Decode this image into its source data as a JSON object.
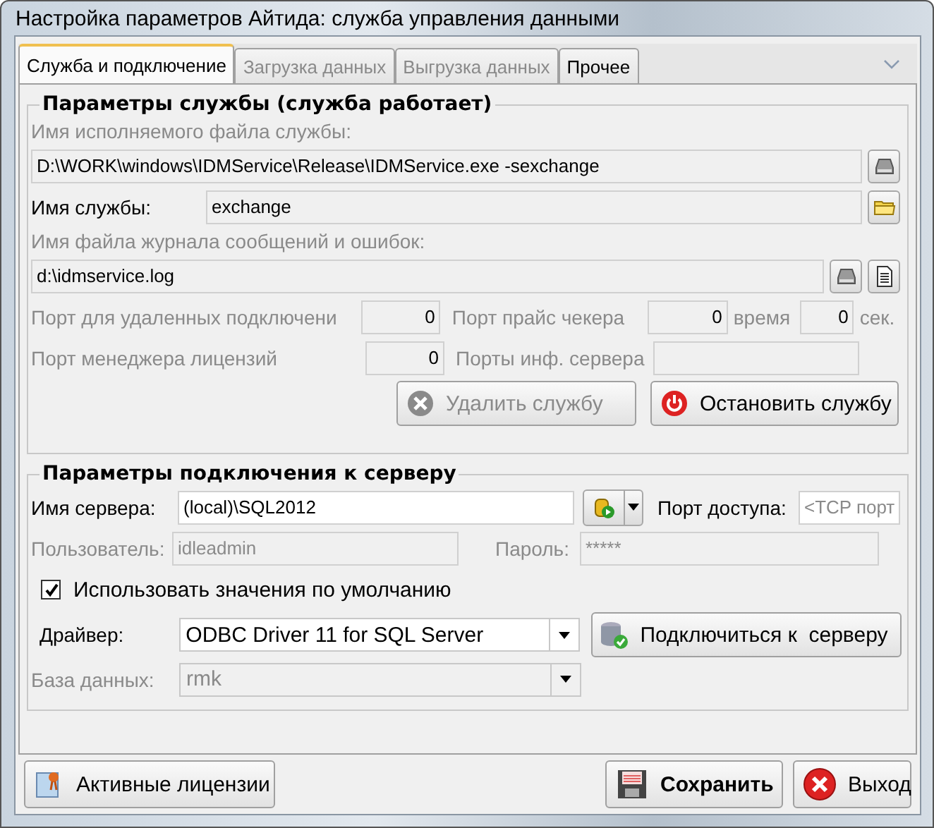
{
  "window": {
    "title": "Настройка параметров Айтида: служба управления данными"
  },
  "tabs": [
    {
      "label": "Служба и подключение",
      "selected": true,
      "disabled": false
    },
    {
      "label": "Загрузка данных",
      "selected": false,
      "disabled": true
    },
    {
      "label": "Выгрузка данных",
      "selected": false,
      "disabled": true
    },
    {
      "label": "Прочее",
      "selected": false,
      "disabled": false
    }
  ],
  "service_group": {
    "title": "Параметры службы (служба работает)",
    "exe_label": "Имя исполняемого файла службы:",
    "exe_path": "D:\\WORK\\windows\\IDMService\\Release\\IDMService.exe -sexchange",
    "service_name_label": "Имя службы:",
    "service_name": "exchange",
    "log_label": "Имя файла журнала сообщений и ошибок:",
    "log_path": "d:\\idmservice.log",
    "remote_port_label": "Порт для удаленных подключени",
    "remote_port": "0",
    "price_port_label": "Порт прайс чекера",
    "price_port": "0",
    "time_label": "время",
    "time": "0",
    "seconds_label": "сек.",
    "license_port_label": "Порт менеджера лицензий",
    "license_port": "0",
    "info_ports_label": "Порты инф. сервера",
    "buttons": [
      {
        "label": "Удалить службу",
        "disabled": true
      },
      {
        "label": "Остановить службу",
        "disabled": false
      }
    ]
  },
  "server_group": {
    "title": "Параметры подключения к серверу",
    "server_label": "Имя сервера:",
    "server": "(local)\\SQL2012",
    "port_label": "Порт доступа:",
    "port_placeholder": "<TCP порт",
    "user_label": "Пользователь:",
    "user": "idleadmin",
    "user_disabled": true,
    "password_label": "Пароль:",
    "password": "*****",
    "use_defaults": {
      "label": "Использовать значения по умолчанию",
      "checked": true
    },
    "driver_label": "Драйвер:",
    "driver": "ODBC Driver 11 for SQL Server",
    "connect_button": "Подключиться к  серверу",
    "database_label": "База данных:",
    "database": "rmk",
    "database_disabled": true
  },
  "footer_buttons": [
    {
      "kind": "licenses",
      "label": "Активные лицензии"
    },
    {
      "kind": "save",
      "label": "Сохранить"
    },
    {
      "kind": "exit",
      "label": "Выход"
    }
  ]
}
